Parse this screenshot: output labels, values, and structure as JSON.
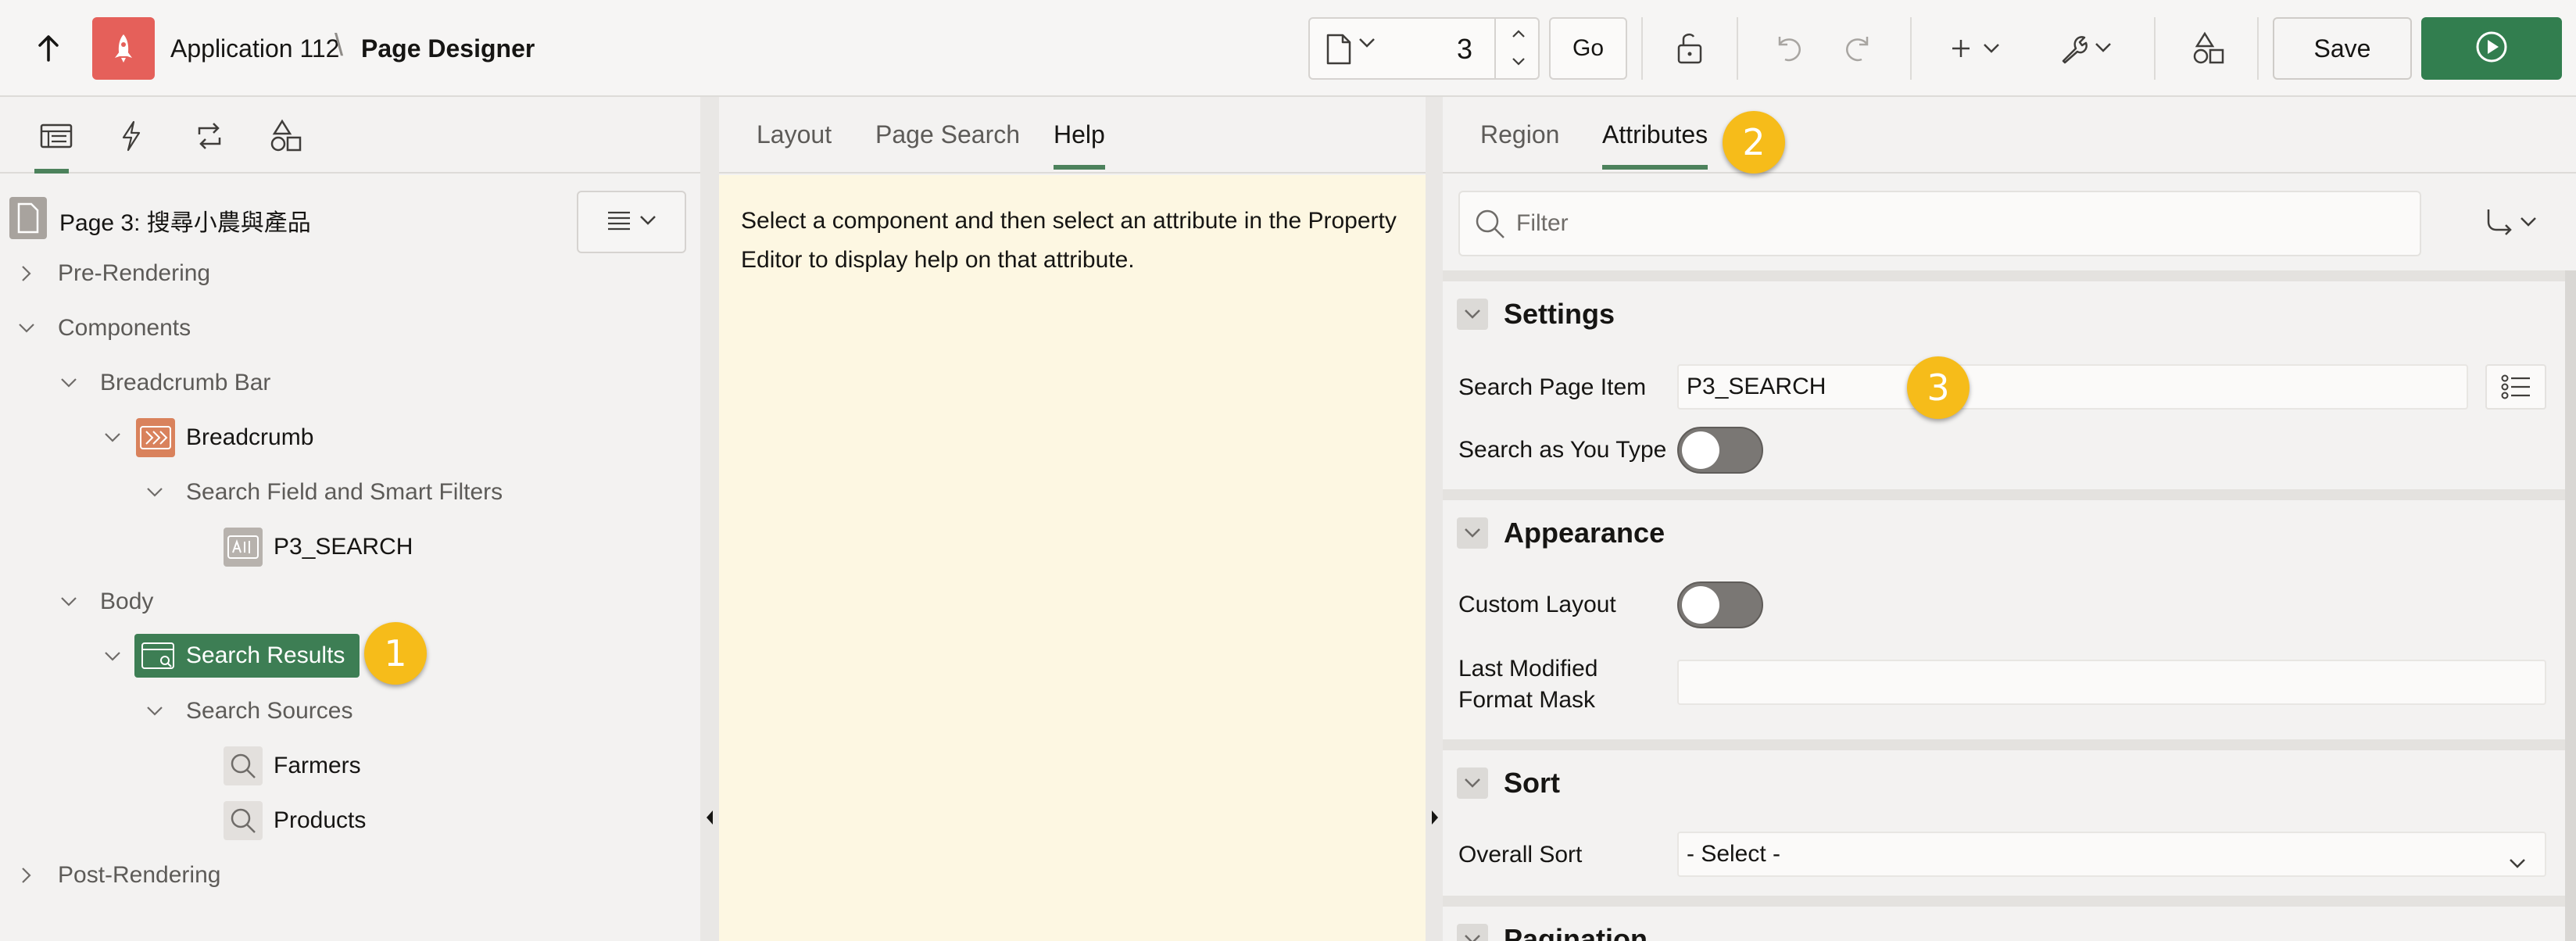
{
  "app": {
    "title": "Application 112",
    "page_designer": "Page Designer",
    "brand_color": "#e5605a"
  },
  "toolbar": {
    "page_number": "3",
    "go_label": "Go",
    "save_label": "Save",
    "run_color": "#327e4f",
    "icons": [
      "up-arrow-icon",
      "rocket-icon",
      "page-icon",
      "lock-icon",
      "undo-icon",
      "redo-icon",
      "plus-icon",
      "wrench-icon",
      "shapes-icon",
      "run-icon"
    ]
  },
  "left": {
    "tabs": [
      "rendering-tab",
      "dynamic-actions-tab",
      "processing-tab",
      "shared-components-tab"
    ],
    "page_title": "Page 3: 搜尋小農與產品",
    "tree": {
      "pre_rendering": "Pre-Rendering",
      "components": "Components",
      "breadcrumb_bar": "Breadcrumb Bar",
      "breadcrumb": "Breadcrumb",
      "search_field": "Search Field and Smart Filters",
      "p3_search": "P3_SEARCH",
      "body": "Body",
      "search_results": "Search Results",
      "search_sources": "Search Sources",
      "farmers": "Farmers",
      "products": "Products",
      "post_rendering": "Post-Rendering"
    },
    "selected_color": "#3d7e54"
  },
  "middle": {
    "tabs": {
      "layout": "Layout",
      "page_search": "Page Search",
      "help": "Help"
    },
    "help_text": "Select a component and then select an attribute in the Property Editor to display help on that attribute."
  },
  "right": {
    "tabs": {
      "region": "Region",
      "attributes": "Attributes"
    },
    "filter_placeholder": "Filter",
    "groups": {
      "settings": "Settings",
      "appearance": "Appearance",
      "sort": "Sort",
      "pagination": "Pagination"
    },
    "props": {
      "search_page_item_label": "Search Page Item",
      "search_page_item_value": "P3_SEARCH",
      "search_as_you_type_label": "Search as You Type",
      "custom_layout_label": "Custom Layout",
      "last_modified_line1": "Last Modified",
      "last_modified_line2": "Format Mask",
      "last_modified_value": "",
      "overall_sort_label": "Overall Sort",
      "overall_sort_value": "- Select -"
    }
  },
  "callouts": {
    "one": "1",
    "two": "2",
    "three": "3",
    "color": "#f6bc1a"
  }
}
